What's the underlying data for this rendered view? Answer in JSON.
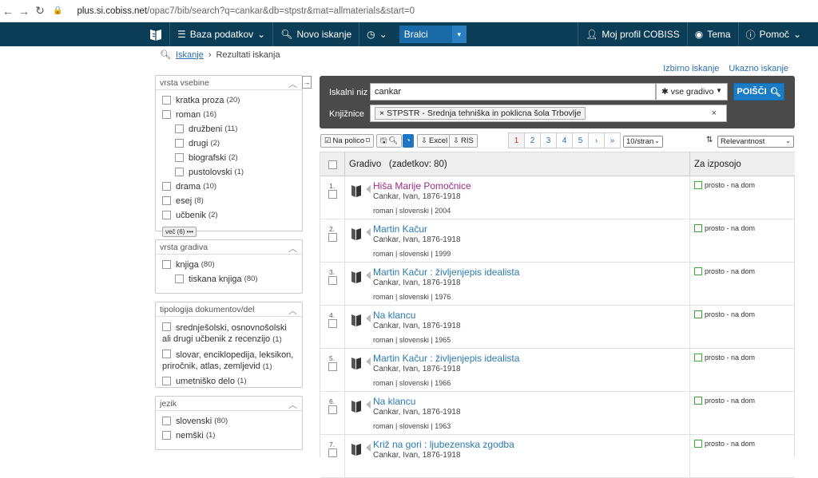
{
  "browser": {
    "url_host": "plus.si.cobiss.net",
    "url_path": "/opac7/bib/search?q=cankar&db=stpstr&mat=allmaterials&start=0"
  },
  "topnav": {
    "baza": "Baza podatkov",
    "novo": "Novo iskanje",
    "bralci": "Bralci",
    "profil": "Moj profil COBISS",
    "tema": "Tema",
    "pomoc": "Pomoč"
  },
  "breadcrumb": {
    "iskanje": "Iskanje",
    "sep": "›",
    "rezultati": "Rezultati iskanja"
  },
  "toplinks": {
    "izbirno": "Izbirno iskanje",
    "ukazno": "Ukazno iskanje"
  },
  "facets": {
    "vsebina": {
      "title": "vrsta vsebine",
      "items": [
        {
          "label": "kratka proza",
          "count": "(20)"
        },
        {
          "label": "roman",
          "count": "(16)"
        },
        {
          "label": "družbeni",
          "count": "(11)"
        },
        {
          "label": "drugi",
          "count": "(2)"
        },
        {
          "label": "biografski",
          "count": "(2)"
        },
        {
          "label": "pustolovski",
          "count": "(1)"
        },
        {
          "label": "drama",
          "count": "(10)"
        },
        {
          "label": "esej",
          "count": "(8)"
        },
        {
          "label": "učbenik",
          "count": "(2)"
        }
      ],
      "more": "več (6) •••"
    },
    "gradiva": {
      "title": "vrsta gradiva",
      "items": [
        {
          "label": "knjiga",
          "count": "(80)"
        },
        {
          "label": "tiskana knjiga",
          "count": "(80)"
        }
      ]
    },
    "tipologija": {
      "title": "tipologija dokumentov/del",
      "items": [
        {
          "label": "srednješolski, osnovnošolski ali drugi učbenik z recenzijo",
          "count": "(1)"
        },
        {
          "label": "slovar, enciklopedija, leksikon, priročnik, atlas, zemljevid",
          "count": "(1)"
        },
        {
          "label": "umetniško delo",
          "count": "(1)"
        }
      ]
    },
    "jezik": {
      "title": "jezik",
      "items": [
        {
          "label": "slovenski",
          "count": "(80)"
        },
        {
          "label": "nemški",
          "count": "(1)"
        }
      ]
    }
  },
  "search": {
    "label_niz": "Iskalni niz",
    "query": "cankar",
    "gradivo": "vse gradivo",
    "button": "POIŠČI",
    "label_knj": "Knjižnice",
    "library": "STPSTR - Srednja tehniška in poklicna šola Trbovlje"
  },
  "toolbar": {
    "polico": "Na polico",
    "excel": "Excel",
    "ris": "RIS",
    "pages": [
      "1",
      "2",
      "3",
      "4",
      "5",
      "›",
      "»"
    ],
    "perpage": "10/stran",
    "sort": "Relevantnost"
  },
  "table": {
    "header_gradivo": "Gradivo",
    "header_count": "(zadetkov: 80)",
    "header_izposojo": "Za izposojo",
    "rows": [
      {
        "num": "1.",
        "title": "Hiša Marije Pomočnice",
        "author": "Cankar, Ivan, 1876-1918",
        "meta": "roman | slovenski | 2004",
        "status": "prosto - na dom"
      },
      {
        "num": "2.",
        "title": "Martin Kačur",
        "author": "Cankar, Ivan, 1876-1918",
        "meta": "roman | slovenski | 1999",
        "status": "prosto - na dom"
      },
      {
        "num": "3.",
        "title": "Martin Kačur : življenjepis idealista",
        "author": "Cankar, Ivan, 1876-1918",
        "meta": "roman | slovenski | 1976",
        "status": "prosto - na dom"
      },
      {
        "num": "4.",
        "title": "Na klancu",
        "author": "Cankar, Ivan, 1876-1918",
        "meta": "roman | slovenski | 1965",
        "status": "prosto - na dom"
      },
      {
        "num": "5.",
        "title": "Martin Kačur : življenjepis idealista",
        "author": "Cankar, Ivan, 1876-1918",
        "meta": "roman | slovenski | 1966",
        "status": "prosto - na dom"
      },
      {
        "num": "6.",
        "title": "Na klancu",
        "author": "Cankar, Ivan, 1876-1918",
        "meta": "roman | slovenski | 1963",
        "status": "prosto - na dom"
      },
      {
        "num": "7.",
        "title": "Križ na gori : ljubezenska zgodba",
        "author": "Cankar, Ivan, 1876-1918",
        "meta": "",
        "status": "prosto - na dom"
      }
    ]
  }
}
